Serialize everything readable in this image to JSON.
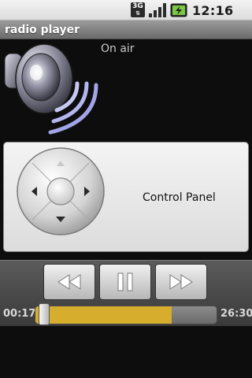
{
  "status_bar": {
    "network_type": "3G",
    "network_arrows": "⇅",
    "time": "12:16 PM"
  },
  "app": {
    "title": "radio player"
  },
  "now_playing": {
    "status_text": "On air"
  },
  "control_panel": {
    "label": "Control Panel"
  },
  "player": {
    "elapsed": "00:17",
    "total": "26:30",
    "progress_fraction": 0.011,
    "buffer_fraction": 0.75,
    "buttons": {
      "rewind": "rewind-icon",
      "pause": "pause-icon",
      "fast_forward": "fast-forward-icon"
    }
  },
  "colors": {
    "buffer_fill": "#d6ad2c",
    "title_bar": "#8a8a8a",
    "background": "#0d0d0d"
  }
}
